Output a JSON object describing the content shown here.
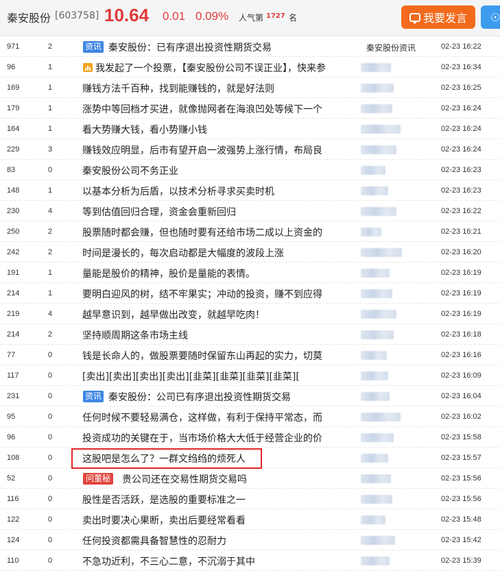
{
  "header": {
    "stock_name": "秦安股份",
    "stock_code": "[603758]",
    "price": "10.64",
    "change": "0.01",
    "change_pct": "0.09%",
    "popularity_label": "人气第",
    "popularity_rank": "1727",
    "popularity_unit": "名",
    "post_button": "我要发言",
    "colors": {
      "up": "#e03a3a",
      "post_button": "#f26b1d",
      "tip_button": "#3d9bef",
      "tag_news": "#3d86e3",
      "tag_ask": "#e0463f",
      "highlight": "#e0262a"
    }
  },
  "posts": [
    {
      "read": "971",
      "reply": "2",
      "tag": "资讯",
      "title": "秦安股份：已有序退出投资性期货交易",
      "author": "秦安股份资讯",
      "time": "02-23 16:22"
    },
    {
      "read": "96",
      "reply": "1",
      "tag": "vote",
      "title": "我发起了一个投票，【秦安股份公司不误正业】，快来参",
      "author": "",
      "time": "02-23 16:34"
    },
    {
      "read": "169",
      "reply": "1",
      "tag": "",
      "title": "赚钱方法千百种，找到能赚钱的，就是好法则",
      "author": "",
      "time": "02-23 16:25"
    },
    {
      "read": "179",
      "reply": "1",
      "tag": "",
      "title": "涨势中等回档才买进，就像抛网者在海浪凹处等候下一个",
      "author": "",
      "time": "02-23 16:24"
    },
    {
      "read": "164",
      "reply": "1",
      "tag": "",
      "title": "看大势赚大钱，看小势赚小钱",
      "author": "",
      "time": "02-23 16:24"
    },
    {
      "read": "229",
      "reply": "3",
      "tag": "",
      "title": "赚钱效应明显，后市有望开启一波强势上涨行情，布局良",
      "author": "",
      "time": "02-23 16:24"
    },
    {
      "read": "83",
      "reply": "0",
      "tag": "",
      "title": "秦安股份公司不务正业",
      "author": "",
      "time": "02-23 16:23"
    },
    {
      "read": "148",
      "reply": "1",
      "tag": "",
      "title": "以基本分析为后盾，以技术分析寻求买卖时机",
      "author": "",
      "time": "02-23 16:23"
    },
    {
      "read": "230",
      "reply": "4",
      "tag": "",
      "title": "等到估值回归合理，资金会重新回归",
      "author": "",
      "time": "02-23 16:22"
    },
    {
      "read": "250",
      "reply": "2",
      "tag": "",
      "title": "股票随时都会赚，但也随时要有还给市场二成以上资金的",
      "author": "",
      "time": "02-23 16:21"
    },
    {
      "read": "242",
      "reply": "2",
      "tag": "",
      "title": "时间是漫长的，每次启动都是大幅度的波段上涨",
      "author": "",
      "time": "02-23 16:20"
    },
    {
      "read": "191",
      "reply": "1",
      "tag": "",
      "title": "量能是股价的精神，股价是量能的表情。",
      "author": "",
      "time": "02-23 16:19"
    },
    {
      "read": "214",
      "reply": "1",
      "tag": "",
      "title": "要明白迎风的树，结不牢果实；冲动的投资，赚不到应得",
      "author": "",
      "time": "02-23 16:19"
    },
    {
      "read": "219",
      "reply": "4",
      "tag": "",
      "title": "越早意识到，越早做出改变，就越早吃肉！",
      "author": "",
      "time": "02-23 16:19"
    },
    {
      "read": "214",
      "reply": "2",
      "tag": "",
      "title": "坚持顺周期这条市场主线",
      "author": "",
      "time": "02-23 16:18"
    },
    {
      "read": "77",
      "reply": "0",
      "tag": "",
      "title": "钱是长命人的，做股票要随时保留东山再起的实力，切莫",
      "author": "",
      "time": "02-23 16:16"
    },
    {
      "read": "117",
      "reply": "0",
      "tag": "",
      "title": "[卖出][卖出][卖出][卖出][韭菜][韭菜][韭菜][韭菜][",
      "author": "",
      "time": "02-23 16:09"
    },
    {
      "read": "231",
      "reply": "0",
      "tag": "资讯",
      "title": "秦安股份：公司已有序退出投资性期货交易",
      "author": "",
      "time": "02-23 16:04"
    },
    {
      "read": "95",
      "reply": "0",
      "tag": "",
      "title": "任何时候不要轻易满仓，这样做，有利于保持平常态，而",
      "author": "",
      "time": "02-23 16:02"
    },
    {
      "read": "96",
      "reply": "0",
      "tag": "",
      "title": "投资成功的关键在于，当市场价格大大低于经营企业的价",
      "author": "",
      "time": "02-23 15:58"
    },
    {
      "read": "108",
      "reply": "0",
      "tag": "",
      "title": "这股吧是怎么了？一群文绉绉的烦死人",
      "author": "",
      "time": "02-23 15:57"
    },
    {
      "read": "52",
      "reply": "0",
      "tag": "问董秘",
      "title": "贵公司还在交易性期货交易吗",
      "author": "",
      "time": "02-23 15:56"
    },
    {
      "read": "116",
      "reply": "0",
      "tag": "",
      "title": "股性是否活跃，是选股的重要标准之一",
      "author": "",
      "time": "02-23 15:56"
    },
    {
      "read": "122",
      "reply": "0",
      "tag": "",
      "title": "卖出时要决心果断，卖出后要经常看看",
      "author": "",
      "time": "02-23 15:48"
    },
    {
      "read": "124",
      "reply": "0",
      "tag": "",
      "title": "任何投资都需具备智慧性的忍耐力",
      "author": "",
      "time": "02-23 15:42"
    },
    {
      "read": "110",
      "reply": "0",
      "tag": "",
      "title": "不急功近利，不三心二意，不沉溺于其中",
      "author": "",
      "time": "02-23 15:39"
    }
  ]
}
